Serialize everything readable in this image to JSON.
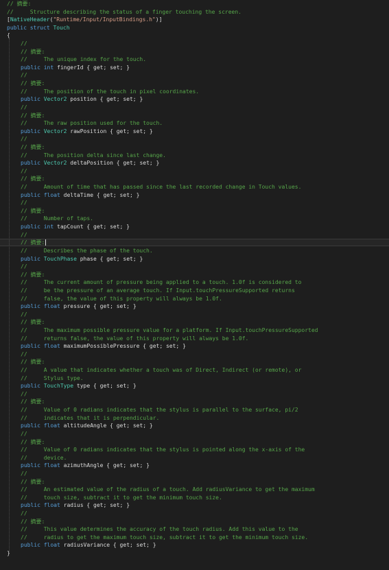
{
  "colors": {
    "background": "#1e1e1e",
    "comment": "#57a64a",
    "keyword": "#569cd6",
    "type": "#4ec9b0",
    "string": "#d69d85",
    "text": "#dcdcdc"
  },
  "header": {
    "summary_comment": "// 摘要:",
    "desc_comment": "//     Structure describing the status of a finger touching the screen.",
    "attr_open": "[",
    "attr_name": "NativeHeader",
    "attr_paren_open": "(",
    "attr_string": "\"Runtime/Input/InputBindings.h\"",
    "attr_close": ")]",
    "struct_keyword1": "public",
    "struct_keyword2": "struct",
    "struct_name": "Touch",
    "open_brace": "{",
    "close_brace": "}"
  },
  "common": {
    "comment_empty": "//",
    "summary": "// 摘要:",
    "public": "public",
    "get_set": "{ get; set; }"
  },
  "members": [
    {
      "desc": [
        "//     The unique index for the touch."
      ],
      "type": "int",
      "type_kind": "keyword",
      "name": "fingerId"
    },
    {
      "desc": [
        "//     The position of the touch in pixel coordinates."
      ],
      "type": "Vector2",
      "type_kind": "type",
      "name": "position"
    },
    {
      "desc": [
        "//     The raw position used for the touch."
      ],
      "type": "Vector2",
      "type_kind": "type",
      "name": "rawPosition"
    },
    {
      "desc": [
        "//     The position delta since last change."
      ],
      "type": "Vector2",
      "type_kind": "type",
      "name": "deltaPosition"
    },
    {
      "desc": [
        "//     Amount of time that has passed since the last recorded change in Touch values."
      ],
      "type": "float",
      "type_kind": "keyword",
      "name": "deltaTime"
    },
    {
      "desc": [
        "//     Number of taps."
      ],
      "type": "int",
      "type_kind": "keyword",
      "name": "tapCount"
    },
    {
      "desc": [
        "//     Describes the phase of the touch."
      ],
      "type": "TouchPhase",
      "type_kind": "type",
      "name": "phase"
    },
    {
      "desc": [
        "//     The current amount of pressure being applied to a touch. 1.0f is considered to",
        "//     be the pressure of an average touch. If Input.touchPressureSupported returns",
        "//     false, the value of this property will always be 1.0f."
      ],
      "type": "float",
      "type_kind": "keyword",
      "name": "pressure"
    },
    {
      "desc": [
        "//     The maximum possible pressure value for a platform. If Input.touchPressureSupported",
        "//     returns false, the value of this property will always be 1.0f."
      ],
      "type": "float",
      "type_kind": "keyword",
      "name": "maximumPossiblePressure"
    },
    {
      "desc": [
        "//     A value that indicates whether a touch was of Direct, Indirect (or remote), or",
        "//     Stylus type."
      ],
      "type": "TouchType",
      "type_kind": "type",
      "name": "type"
    },
    {
      "desc": [
        "//     Value of 0 radians indicates that the stylus is parallel to the surface, pi/2",
        "//     indicates that it is perpendicular."
      ],
      "type": "float",
      "type_kind": "keyword",
      "name": "altitudeAngle"
    },
    {
      "desc": [
        "//     Value of 0 radians indicates that the stylus is pointed along the x-axis of the",
        "//     device."
      ],
      "type": "float",
      "type_kind": "keyword",
      "name": "azimuthAngle"
    },
    {
      "desc": [
        "//     An estimated value of the radius of a touch. Add radiusVariance to get the maximum",
        "//     touch size, subtract it to get the minimum touch size."
      ],
      "type": "float",
      "type_kind": "keyword",
      "name": "radius"
    },
    {
      "desc": [
        "//     This value determines the accuracy of the touch radius. Add this value to the",
        "//     radius to get the maximum touch size, subtract it to get the minimum touch size."
      ],
      "type": "float",
      "type_kind": "keyword",
      "name": "radiusVariance"
    }
  ]
}
